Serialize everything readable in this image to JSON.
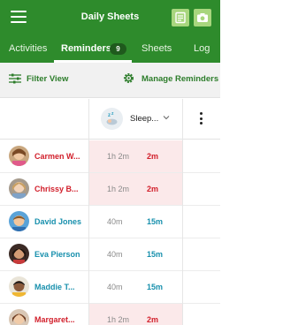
{
  "header": {
    "title": "Daily Sheets",
    "menu_icon": "hamburger-menu-icon",
    "action_icons": [
      "notes-icon",
      "camera-icon"
    ],
    "accent_color": "#2e8b2c",
    "button_color": "#a8d67e"
  },
  "tabs": [
    {
      "label": "Activities",
      "active": false
    },
    {
      "label": "Reminders",
      "active": true,
      "badge": "9"
    },
    {
      "label": "Sheets",
      "active": false
    },
    {
      "label": "Log",
      "active": false
    }
  ],
  "toolbar": {
    "filter_label": "Filter View",
    "filter_icon": "sliders-icon",
    "manage_label": "Manage Reminders",
    "manage_icon": "gear-icon"
  },
  "reminder_column": {
    "label": "Sleep...",
    "icon": "sleep-zz-icon"
  },
  "rows": [
    {
      "name": "Carmen W...",
      "elapsed": "1h 2m",
      "goal": "2m",
      "status": "overdue"
    },
    {
      "name": "Chrissy B...",
      "elapsed": "1h 2m",
      "goal": "2m",
      "status": "overdue"
    },
    {
      "name": "David Jones",
      "elapsed": "40m",
      "goal": "15m",
      "status": "ok"
    },
    {
      "name": "Eva Pierson",
      "elapsed": "40m",
      "goal": "15m",
      "status": "ok"
    },
    {
      "name": "Maddie T...",
      "elapsed": "40m",
      "goal": "15m",
      "status": "ok"
    },
    {
      "name": "Margaret...",
      "elapsed": "1h 2m",
      "goal": "2m",
      "status": "overdue"
    }
  ]
}
